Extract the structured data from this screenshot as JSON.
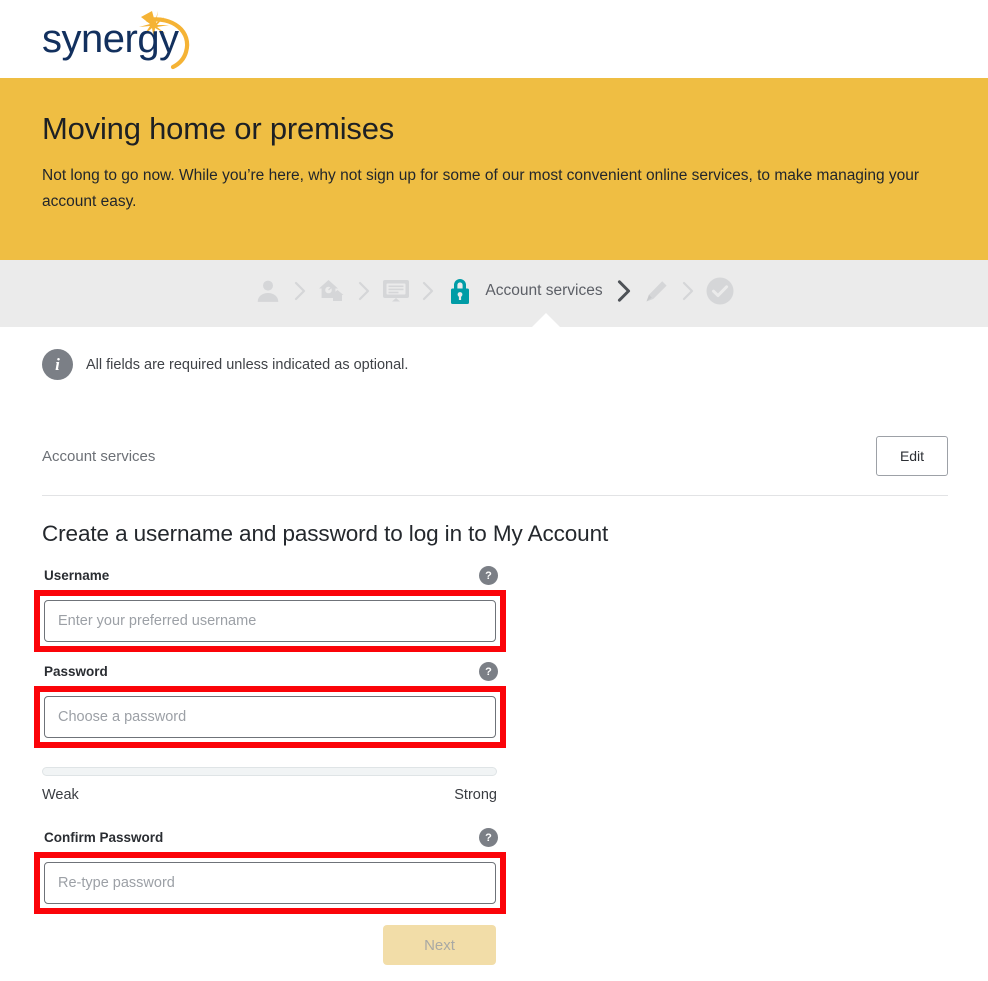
{
  "brand": {
    "logo_text": "synergy",
    "navy": "#12305e",
    "gold": "#f5b335"
  },
  "colors": {
    "banner_bg": "#efbe43",
    "stepper_bg": "#ebebeb",
    "active_step": "#009ca6",
    "highlight": "#fb0409",
    "next_disabled_bg": "#f2dda8"
  },
  "banner": {
    "title": "Moving home or premises",
    "subtitle": "Not long to go now. While you’re here, why not sign up for some of our most convenient online services, to make managing your account easy."
  },
  "stepper": {
    "steps": [
      {
        "icon": "person-icon",
        "label": "",
        "state": "complete"
      },
      {
        "icon": "chevron-right-icon",
        "label": "",
        "state": "separator"
      },
      {
        "icon": "house-icon",
        "label": "",
        "state": "complete"
      },
      {
        "icon": "chevron-right-icon",
        "label": "",
        "state": "separator"
      },
      {
        "icon": "monitor-icon",
        "label": "",
        "state": "complete"
      },
      {
        "icon": "chevron-right-icon",
        "label": "",
        "state": "separator"
      },
      {
        "icon": "lock-icon",
        "label": "Account services",
        "state": "current"
      },
      {
        "icon": "chevron-right-icon",
        "label": "",
        "state": "separator-active"
      },
      {
        "icon": "pencil-icon",
        "label": "",
        "state": "upcoming"
      },
      {
        "icon": "chevron-right-icon",
        "label": "",
        "state": "separator"
      },
      {
        "icon": "check-circle-icon",
        "label": "",
        "state": "upcoming"
      }
    ],
    "current_label": "Account services"
  },
  "notice": {
    "icon": "info-icon",
    "glyph": "i",
    "text": "All fields are required unless indicated as optional."
  },
  "account_section": {
    "label": "Account services",
    "edit_label": "Edit"
  },
  "form": {
    "heading": "Create a username and password to log in to My Account",
    "help_glyph": "?",
    "fields": [
      {
        "name": "username",
        "label": "Username",
        "placeholder": "Enter your preferred username",
        "value": "",
        "type": "text",
        "highlighted": true
      },
      {
        "name": "password",
        "label": "Password",
        "placeholder": "Choose a password",
        "value": "",
        "type": "password",
        "highlighted": true
      },
      {
        "name": "confirm_password",
        "label": "Confirm Password",
        "placeholder": "Re-type password",
        "value": "",
        "type": "password",
        "highlighted": true
      }
    ],
    "strength": {
      "weak_label": "Weak",
      "strong_label": "Strong",
      "fill_percent": 0
    },
    "next_label": "Next",
    "next_disabled": true
  }
}
